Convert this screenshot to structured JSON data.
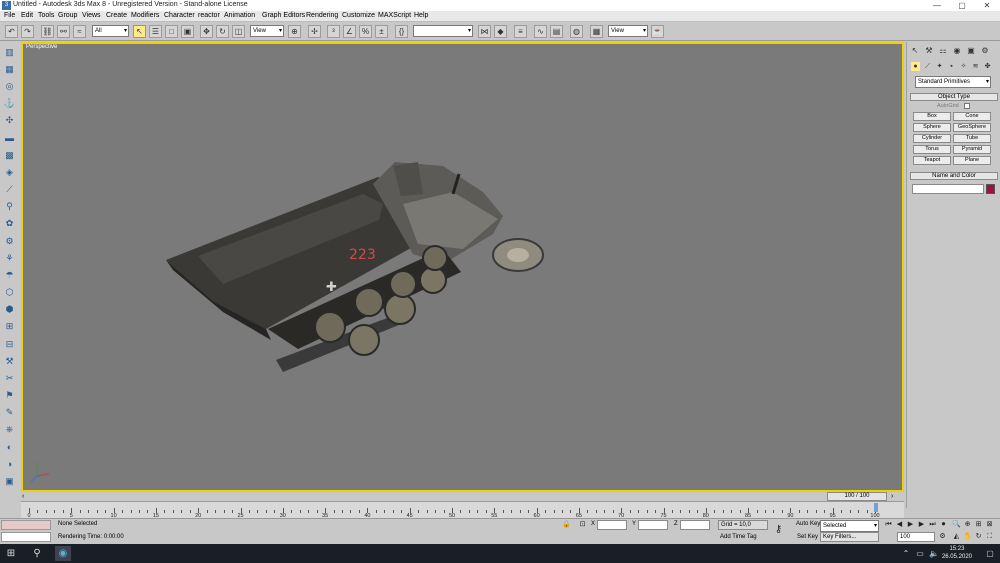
{
  "window": {
    "title": "Untitled - Autodesk 3ds Max 8 - Unregistered Version - Stand-alone License",
    "minimize": "—",
    "maximize": "▢",
    "close": "✕"
  },
  "menu": [
    "File",
    "Edit",
    "Tools",
    "Group",
    "Views",
    "Create",
    "Modifiers",
    "Character",
    "reactor",
    "Animation",
    "Graph Editors",
    "Rendering",
    "Customize",
    "MAXScript",
    "Help"
  ],
  "toolbar": {
    "selection_filter": "All",
    "coord_system": "View",
    "named_selection": "",
    "render_view": "View"
  },
  "viewport": {
    "label": "Perspective",
    "border_color": "#f2d000",
    "background": "#7a7a7a",
    "model_decal": "223"
  },
  "command_panel": {
    "category_dropdown": "Standard Primitives",
    "object_type_header": "Object Type",
    "autogrid_label": "AutoGrid",
    "buttons": [
      "Box",
      "Cone",
      "Sphere",
      "GeoSphere",
      "Cylinder",
      "Tube",
      "Torus",
      "Pyramid",
      "Teapot",
      "Plane"
    ],
    "name_color_header": "Name and Color",
    "object_name": "",
    "color_swatch": "#a0103a"
  },
  "timeline": {
    "frame_display": "100 / 100",
    "ticks": [
      0,
      5,
      10,
      15,
      20,
      25,
      30,
      35,
      40,
      45,
      50,
      55,
      60,
      65,
      70,
      75,
      80,
      85,
      90,
      95,
      100
    ]
  },
  "status": {
    "selection_state": "None Selected",
    "prompt": "Rendering Time: 0:00:00",
    "x_label": "X",
    "y_label": "Y",
    "z_label": "Z",
    "grid": "Grid = 10,0",
    "auto_key": "Auto Key",
    "selected_dropdown": "Selected",
    "set_key": "Set Key",
    "key_filters": "Key Filters...",
    "add_time_tag": "Add Time Tag",
    "current_frame": "100"
  },
  "taskbar": {
    "time": "15:23",
    "date": "26.05.2020"
  }
}
